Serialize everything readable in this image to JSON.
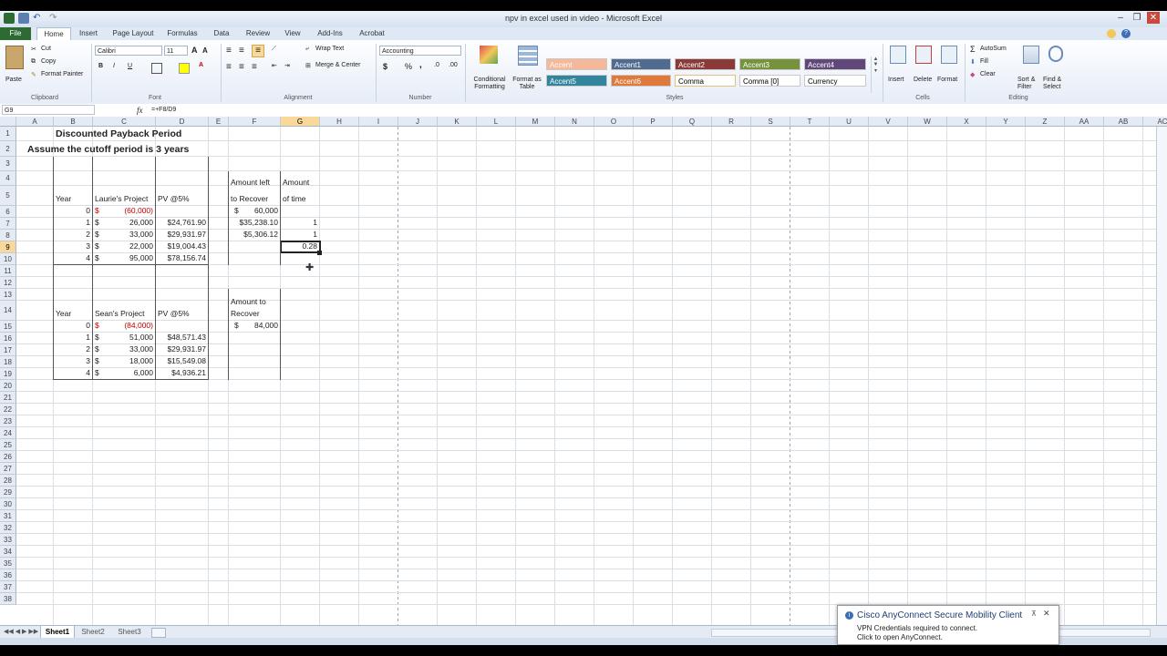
{
  "window": {
    "title": "npv in excel used in video - Microsoft Excel",
    "minimize": "–",
    "restore": "❐",
    "close": "✕"
  },
  "tabs": [
    "File",
    "Home",
    "Insert",
    "Page Layout",
    "Formulas",
    "Data",
    "Review",
    "View",
    "Add-Ins",
    "Acrobat"
  ],
  "ribbon": {
    "clipboard": {
      "paste": "Paste",
      "cut": "Cut",
      "copy": "Copy",
      "format_painter": "Format Painter",
      "label": "Clipboard"
    },
    "font": {
      "name": "Calibri",
      "size": "11",
      "label": "Font",
      "bold": "B",
      "italic": "I",
      "underline": "U"
    },
    "alignment": {
      "wrap_text": "Wrap Text",
      "merge_center": "Merge & Center",
      "label": "Alignment"
    },
    "number": {
      "format": "Accounting",
      "dollar": "$",
      "percent": "%",
      "comma": ",",
      "label": "Number"
    },
    "styles": {
      "conditional": "Conditional Formatting",
      "format_table": "Format as Table",
      "cells": [
        {
          "label": "Accent",
          "bg": "#f6b89a",
          "fg": "#ffffff"
        },
        {
          "label": "Accent1",
          "bg": "#4f6b8f",
          "fg": "#ffffff"
        },
        {
          "label": "Accent2",
          "bg": "#8b3a3a",
          "fg": "#ffffff"
        },
        {
          "label": "Accent3",
          "bg": "#76923c",
          "fg": "#ffffff"
        },
        {
          "label": "Accent4",
          "bg": "#60497a",
          "fg": "#ffffff"
        },
        {
          "label": "Accent5",
          "bg": "#31859c",
          "fg": "#ffffff"
        },
        {
          "label": "Accent6",
          "bg": "#e07a3a",
          "fg": "#ffffff"
        },
        {
          "label": "Comma",
          "bg": "#ffffff",
          "fg": "#000000"
        },
        {
          "label": "Comma [0]",
          "bg": "#ffffff",
          "fg": "#000000"
        },
        {
          "label": "Currency",
          "bg": "#ffffff",
          "fg": "#000000"
        }
      ],
      "label": "Styles"
    },
    "cells": {
      "insert": "Insert",
      "delete": "Delete",
      "format": "Format",
      "label": "Cells"
    },
    "editing": {
      "autosum": "AutoSum",
      "fill": "Fill",
      "clear": "Clear",
      "sort_filter": "Sort & Filter",
      "find_select": "Find & Select",
      "label": "Editing"
    }
  },
  "formula_bar": {
    "name_box": "G9",
    "fx": "fx",
    "formula": "=+F8/D9"
  },
  "columns": [
    "A",
    "B",
    "C",
    "D",
    "E",
    "F",
    "G",
    "H",
    "I",
    "J",
    "K",
    "L",
    "M",
    "N",
    "O",
    "P",
    "Q",
    "R",
    "S",
    "T",
    "U",
    "V",
    "W",
    "X",
    "Y",
    "Z",
    "AA",
    "AB",
    "AC"
  ],
  "rows": [
    "1",
    "2",
    "3",
    "4",
    "5",
    "6",
    "7",
    "8",
    "9",
    "10",
    "11",
    "12",
    "13",
    "14",
    "15",
    "16",
    "17",
    "18",
    "19",
    "20",
    "21",
    "22",
    "23",
    "24",
    "25",
    "26",
    "27",
    "28",
    "29",
    "30",
    "31",
    "32",
    "33",
    "34",
    "35",
    "36",
    "37",
    "38"
  ],
  "selected": {
    "column": "G",
    "row": "9"
  },
  "cells": {
    "title": "Discounted Payback Period",
    "subtitle": "Assume the cutoff period is 3 years",
    "hdr_year1": "Year",
    "hdr_laurie": "Laurie's Project",
    "hdr_pv1": "PV @5%",
    "hdr_left1": "Amount left",
    "hdr_left2": "to Recover",
    "hdr_time1": "Amount",
    "hdr_time2": "of time",
    "l_years": [
      "0",
      "1",
      "2",
      "3",
      "4"
    ],
    "l_dollar": [
      "$",
      "$",
      "$",
      "$",
      "$"
    ],
    "l_cash": [
      "(60,000)",
      "26,000",
      "33,000",
      "22,000",
      "95,000"
    ],
    "l_pv": [
      "",
      "$24,761.90",
      "$29,931.97",
      "$19,004.43",
      "$78,156.74"
    ],
    "l_left_dollar": "$",
    "l_left": [
      "60,000",
      "$35,238.10",
      "$5,306.12"
    ],
    "l_time": [
      "1",
      "1",
      "0.28"
    ],
    "hdr_year2": "Year",
    "hdr_sean": "Sean's Project",
    "hdr_pv2": "PV @5%",
    "hdr_recover1": "Amount to",
    "hdr_recover2": "Recover",
    "s_years": [
      "0",
      "1",
      "2",
      "3",
      "4"
    ],
    "s_dollar": [
      "$",
      "$",
      "$",
      "$",
      "$"
    ],
    "s_cash": [
      "(84,000)",
      "51,000",
      "33,000",
      "18,000",
      "6,000"
    ],
    "s_pv": [
      "",
      "$48,571.43",
      "$29,931.97",
      "$15,549.08",
      "$4,936.21"
    ],
    "s_left_dollar": "$",
    "s_left": "84,000"
  },
  "sheets": [
    "Sheet1",
    "Sheet2",
    "Sheet3"
  ],
  "popup": {
    "title": "Cisco AnyConnect Secure Mobility Client",
    "line1": "VPN Credentials required to connect.",
    "line2": "Click to open AnyConnect."
  }
}
